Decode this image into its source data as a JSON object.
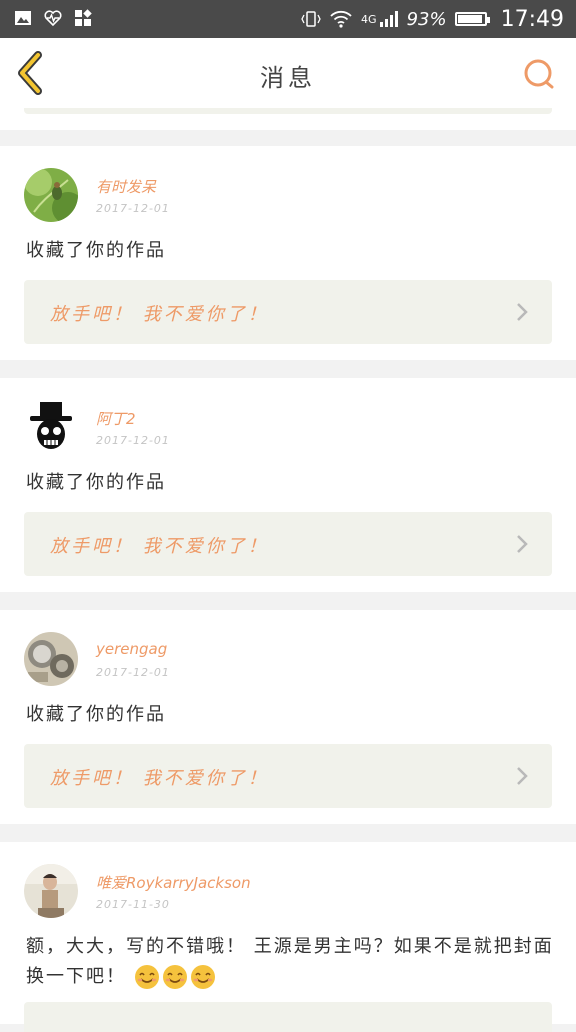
{
  "status_bar": {
    "network": "4G",
    "battery_percent": "93%",
    "battery_level": 0.93,
    "time": "17:49"
  },
  "nav": {
    "title": "消息",
    "back_icon": "chevron-left-icon",
    "search_icon": "search-icon"
  },
  "colors": {
    "accent": "#ee9a67",
    "back_yellow": "#f3c531",
    "card_bg": "#ffffff",
    "work_bg": "#f1f2eb",
    "page_bg": "#f2f2f2"
  },
  "messages": [
    {
      "user": "有时发呆",
      "date": "2017-12-01",
      "text": "收藏了你的作品",
      "work_title": "放手吧！ 我不爱你了！"
    },
    {
      "user": "阿丁2",
      "date": "2017-12-01",
      "text": "收藏了你的作品",
      "work_title": "放手吧！ 我不爱你了！"
    },
    {
      "user": "yerengag",
      "date": "2017-12-01",
      "text": "收藏了你的作品",
      "work_title": "放手吧！ 我不爱你了！"
    },
    {
      "user": "唯爱RoykarryJackson",
      "date": "2017-11-30",
      "text": "额，大大，写的不错哦！ 王源是男主吗？如果不是就把封面换一下吧！",
      "emoji": "smiling-face-emoji"
    }
  ]
}
